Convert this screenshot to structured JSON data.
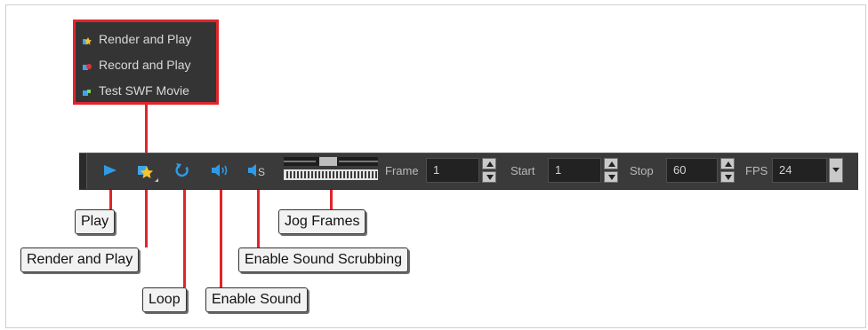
{
  "menu": {
    "items": [
      {
        "label": "Render and Play"
      },
      {
        "label": "Record and Play"
      },
      {
        "label": "Test SWF Movie"
      }
    ]
  },
  "toolbar": {
    "frame_label": "Frame",
    "frame_value": "1",
    "start_label": "Start",
    "start_value": "1",
    "stop_label": "Stop",
    "stop_value": "60",
    "fps_label": "FPS",
    "fps_value": "24",
    "icons": [
      "play-icon",
      "render-and-play-icon",
      "loop-icon",
      "enable-sound-icon",
      "sound-scrubbing-icon",
      "jog-frames-slider"
    ]
  },
  "callouts": {
    "play": "Play",
    "render_and_play": "Render and Play",
    "loop": "Loop",
    "enable_sound": "Enable Sound",
    "enable_sound_scrubbing": "Enable Sound Scrubbing",
    "jog_frames": "Jog Frames"
  },
  "colors": {
    "callout_line": "#e0252b",
    "icon_blue": "#2f9be6",
    "toolbar_bg": "#3a3a3a",
    "menu_bg": "#343434"
  }
}
